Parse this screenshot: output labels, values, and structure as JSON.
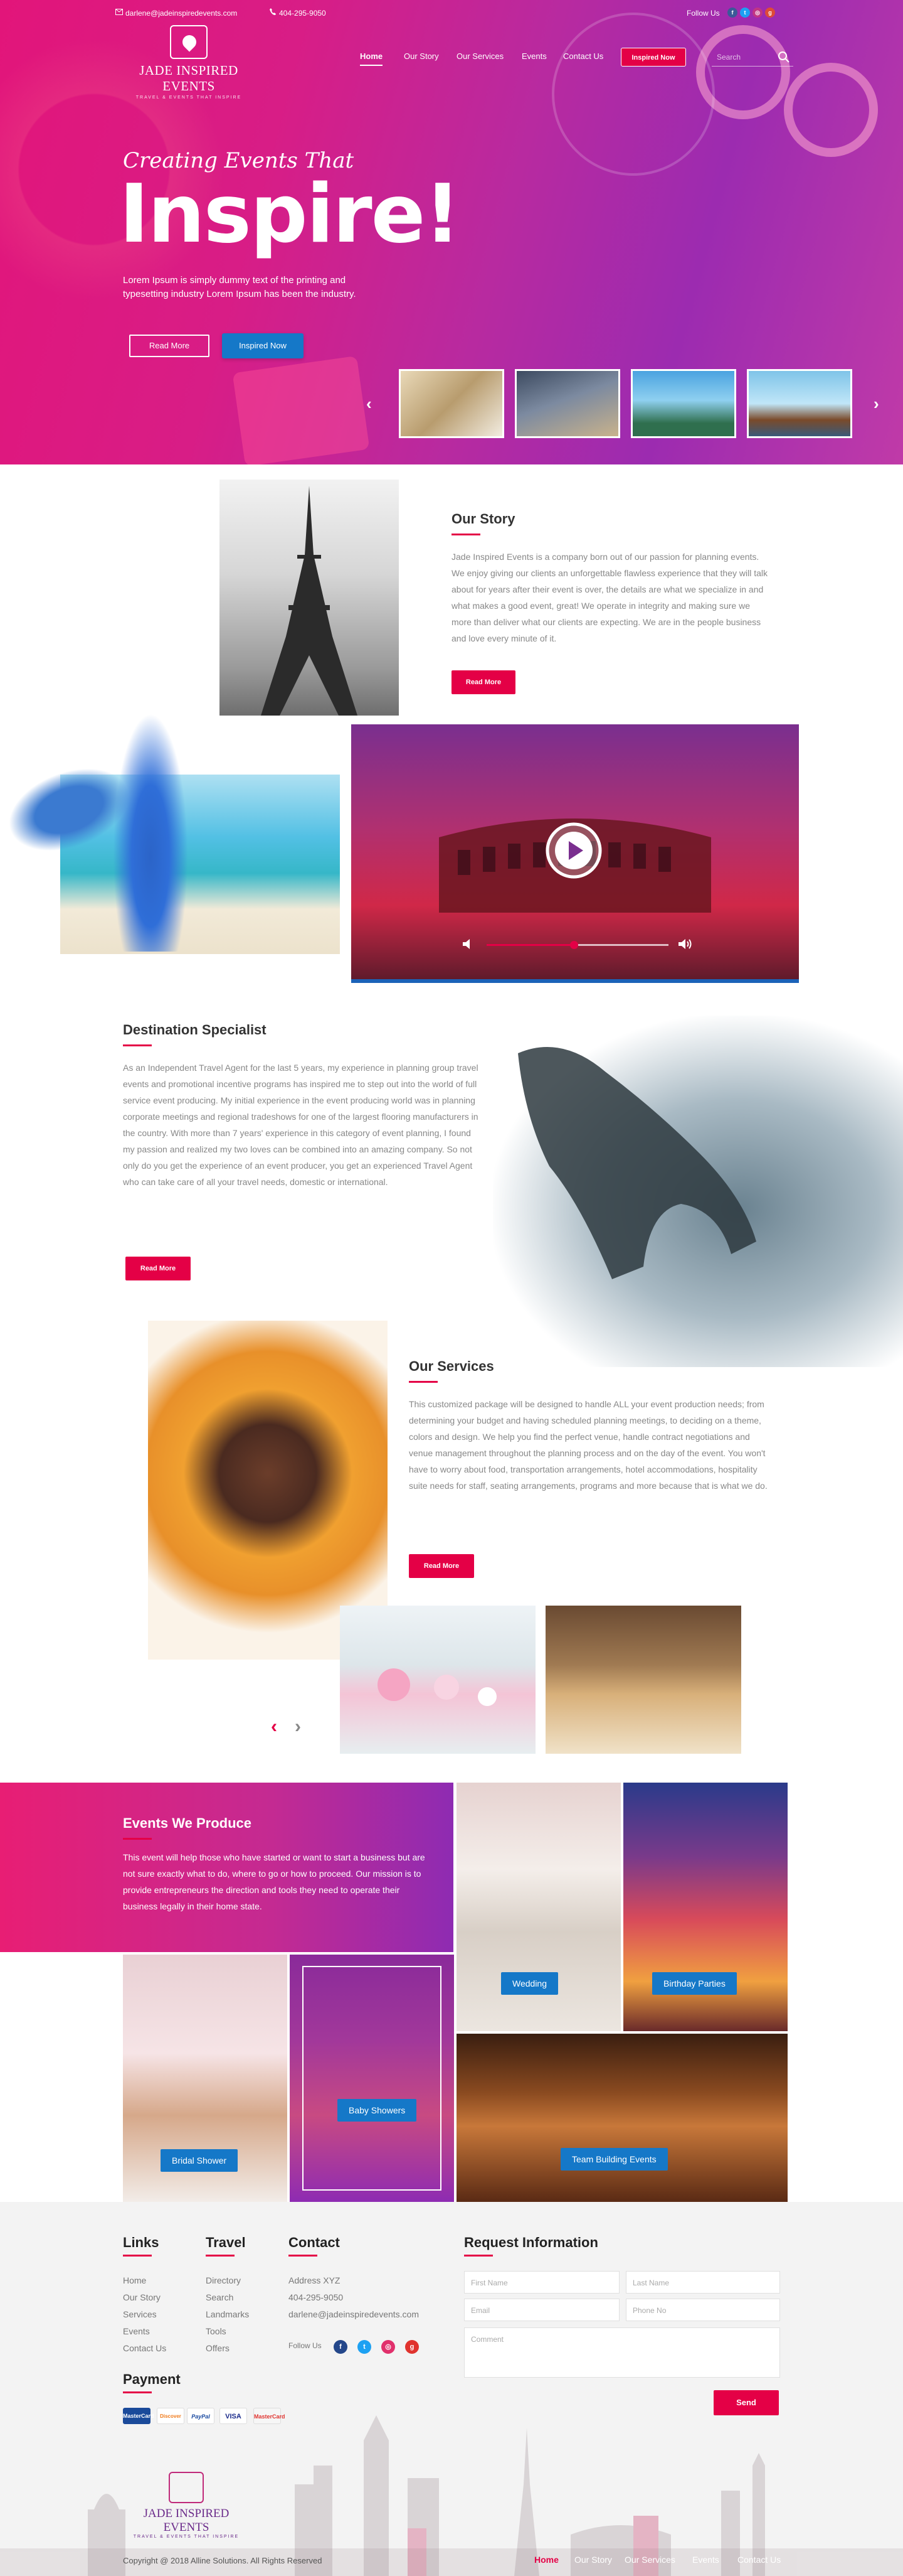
{
  "topbar": {
    "email": "darlene@jadeinspiredevents.com",
    "phone": "404-295-9050",
    "follow_label": "Follow Us"
  },
  "brand": {
    "name": "JADE INSPIRED EVENTS",
    "tagline": "TRAVEL & EVENTS THAT INSPIRE"
  },
  "nav": {
    "items": [
      "Home",
      "Our Story",
      "Our Services",
      "Events",
      "Contact Us"
    ],
    "cta": "Inspired Now",
    "search_placeholder": "Search"
  },
  "hero": {
    "kicker": "Creating Events That",
    "title": "Inspire!",
    "subtitle": "Lorem Ipsum is simply dummy text of the printing and typesetting industry Lorem Ipsum has been the industry.",
    "btn_read_more": "Read More",
    "btn_inspired": "Inspired Now",
    "prev_arrow": "‹",
    "next_arrow": "›"
  },
  "story": {
    "title": "Our Story",
    "text": "Jade Inspired Events is a company born out of our passion for planning events. We enjoy giving our clients an unforgettable flawless experience that they will talk about for years after their event is over, the details are what we specialize in and what makes a good event, great! We operate in integrity and making sure we more than deliver what our clients are expecting. We are in the people business and love every minute of it.",
    "btn": "Read More"
  },
  "video": {
    "progress": 0.48
  },
  "destination": {
    "title": "Destination Specialist",
    "text": "As an Independent Travel Agent for the last 5 years, my experience in planning group travel events and promotional incentive programs has inspired me to step out into the world of full service event producing. My initial experience in the event producing world was in planning corporate meetings and regional tradeshows for one of the largest flooring manufacturers in the country. With more than 7 years' experience in this category of event planning, I found my passion and realized my two loves can be combined into an amazing company. So not only do you get the experience of an event producer, you get an experienced Travel Agent who can take care of all your travel needs, domestic or international.",
    "btn": "Read More"
  },
  "services": {
    "title": "Our Services",
    "text": "This customized package will be designed to handle ALL your event production needs; from determining your budget and having scheduled planning meetings, to deciding on a theme, colors and design. We help you find the perfect venue, handle contract negotiations and venue management throughout the planning process and on the day of the event. You won't have to worry about food, transportation arrangements, hotel accommodations, hospitality suite needs for staff, seating arrangements, programs and more because that is what we do.",
    "btn": "Read More",
    "prev": "‹",
    "next": "›"
  },
  "events": {
    "title": "Events We Produce",
    "text": "This event will help those who have started or want to start a business but are not sure exactly what to do, where to go or how to proceed. Our mission is to provide entrepreneurs the direction and tools they need to operate their business legally in their home state.",
    "labels": {
      "wedding": "Wedding",
      "birthday": "Birthday Parties",
      "bridal": "Bridal Shower",
      "baby": "Baby Showers",
      "team": "Team Building Events"
    }
  },
  "footer": {
    "links_title": "Links",
    "links": [
      "Home",
      "Our Story",
      "Services",
      "Events",
      "Contact Us"
    ],
    "travel_title": "Travel",
    "travel": [
      "Directory",
      "Search",
      "Landmarks",
      "Tools",
      "Offers"
    ],
    "contact_title": "Contact",
    "contact": [
      "Address XYZ",
      "404-295-9050",
      "darlene@jadeinspiredevents.com"
    ],
    "follow_label": "Follow Us",
    "request_title": "Request Information",
    "fields": {
      "first_name": "First Name",
      "last_name": "Last Name",
      "email": "Email",
      "phone": "Phone No",
      "comment": "Comment"
    },
    "send": "Send",
    "payment_title": "Payment",
    "payment_methods": [
      "MasterCard",
      "Discover",
      "PayPal",
      "VISA",
      "MasterCard"
    ],
    "copyright": "Copyright @ 2018 Alline Solutions. All Rights Reserved",
    "bottom_nav": [
      "Home",
      "Our Story",
      "Our Services",
      "Events",
      "Contact Us"
    ]
  },
  "colors": {
    "accent": "#e40046",
    "blue": "#1578c8",
    "hero_start": "#e2157a",
    "hero_end": "#9c2bb0"
  }
}
